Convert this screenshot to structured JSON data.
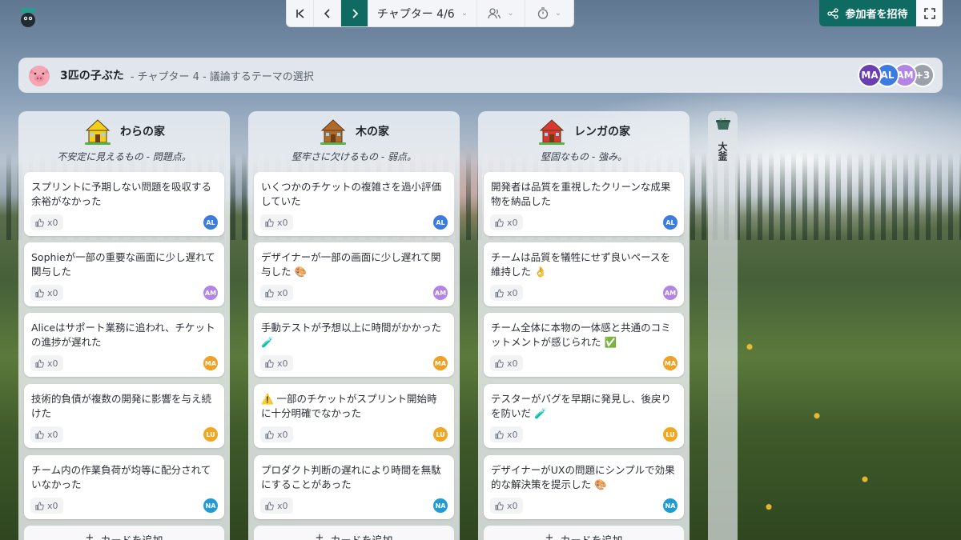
{
  "toolbar": {
    "chapter_label": "チャプター 4/6"
  },
  "invite_label": "参加者を招待",
  "board": {
    "title": "3匹の子ぶた",
    "subtitle": "- チャプター 4 - 議論するテーマの選択"
  },
  "participants": [
    {
      "initials": "MA",
      "color": "#6b3fb0"
    },
    {
      "initials": "AL",
      "color": "#3c7be0"
    },
    {
      "initials": "AM",
      "color": "#b184e6"
    },
    {
      "initials": "+3",
      "color": "#9aa1ab"
    }
  ],
  "columns": [
    {
      "title": "わらの家",
      "description": "不安定に見えるもの - 問題点。",
      "house_color": "#f2cf1a",
      "cards": [
        {
          "text": "スプリントに予期しない問題を吸収する余裕がなかった",
          "likes": "x0",
          "author": "AL",
          "author_color": "#3c7be0"
        },
        {
          "text": "Sophieが一部の重要な画面に少し遅れて関与した",
          "likes": "x0",
          "author": "AM",
          "author_color": "#b184e6"
        },
        {
          "text": "Aliceはサポート業務に追われ、チケットの進捗が遅れた",
          "likes": "x0",
          "author": "MA",
          "author_color": "#f0a022"
        },
        {
          "text": "技術的負債が複数の開発に影響を与え続けた",
          "likes": "x0",
          "author": "LU",
          "author_color": "#f0a822"
        },
        {
          "text": "チーム内の作業負荷が均等に配分されていなかった",
          "likes": "x0",
          "author": "NA",
          "author_color": "#1f9bd6"
        }
      ]
    },
    {
      "title": "木の家",
      "description": "堅牢さに欠けるもの - 弱点。",
      "house_color": "#b06a2a",
      "cards": [
        {
          "text": "いくつかのチケットの複雑さを過小評価していた",
          "likes": "x0",
          "author": "AL",
          "author_color": "#3c7be0"
        },
        {
          "text": "デザイナーが一部の画面に少し遅れて関与した 🎨",
          "likes": "x0",
          "author": "AM",
          "author_color": "#b184e6"
        },
        {
          "text": "手動テストが予想以上に時間がかかった 🧪",
          "likes": "x0",
          "author": "MA",
          "author_color": "#f0a022"
        },
        {
          "text": "⚠️ 一部のチケットがスプリント開始時に十分明確でなかった",
          "likes": "x0",
          "author": "LU",
          "author_color": "#f0a822"
        },
        {
          "text": "プロダクト判断の遅れにより時間を無駄にすることがあった",
          "likes": "x0",
          "author": "NA",
          "author_color": "#1f9bd6"
        }
      ]
    },
    {
      "title": "レンガの家",
      "description": "堅固なもの - 強み。",
      "house_color": "#d8382f",
      "cards": [
        {
          "text": "開発者は品質を重視したクリーンな成果物を納品した",
          "likes": "x0",
          "author": "AL",
          "author_color": "#3c7be0"
        },
        {
          "text": "チームは品質を犠牲にせず良いペースを維持した 👌",
          "likes": "x0",
          "author": "AM",
          "author_color": "#b184e6"
        },
        {
          "text": "チーム全体に本物の一体感と共通のコミットメントが感じられた ✅",
          "likes": "x0",
          "author": "MA",
          "author_color": "#f0a022"
        },
        {
          "text": "テスターがバグを早期に発見し、後戻りを防いだ 🧪",
          "likes": "x0",
          "author": "LU",
          "author_color": "#f0a822"
        },
        {
          "text": "デザイナーがUXの問題にシンプルで効果的な解決策を提示した 🎨",
          "likes": "x0",
          "author": "NA",
          "author_color": "#1f9bd6"
        }
      ]
    }
  ],
  "add_card_label": "カードを追加",
  "side_column": {
    "label": "大釜"
  }
}
